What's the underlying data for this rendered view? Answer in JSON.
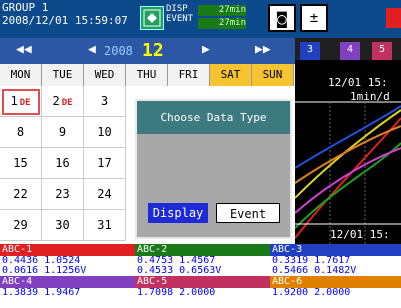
{
  "header": {
    "group": "GROUP 1",
    "datetime": "2008/12/01 15:59:07",
    "disp_label": "DISP",
    "event_label": "EVENT",
    "disp_value": "27min",
    "event_value": "27min"
  },
  "calendar": {
    "year": "2008",
    "month": "12",
    "nav": {
      "prev_year": "◀◀",
      "prev_month": "◀",
      "next_month": "▶",
      "next_year": "▶▶"
    },
    "weekdays": [
      "MON",
      "TUE",
      "WED",
      "THU",
      "FRI",
      "SAT",
      "SUN"
    ],
    "rows": [
      [
        "1",
        "2",
        "3",
        "",
        "",
        "",
        ""
      ],
      [
        "8",
        "9",
        "10",
        "",
        "",
        "",
        ""
      ],
      [
        "15",
        "16",
        "17",
        "",
        "",
        "",
        ""
      ],
      [
        "22",
        "23",
        "24",
        "",
        "",
        "",
        ""
      ],
      [
        "29",
        "30",
        "31",
        "",
        "",
        "",
        ""
      ]
    ],
    "day_mark": "DE"
  },
  "trend": {
    "tabs": [
      "3",
      "4",
      "5"
    ],
    "date_top": "12/01 15:",
    "rate": "1min/d",
    "date_bottom": "12/01 15:"
  },
  "dialog": {
    "title": "Choose Data Type",
    "display_button": "Display",
    "event_button": "Event"
  },
  "channels": [
    {
      "name": "ABC-1",
      "v1": "0.4436 1.0524",
      "v2": "0.0616 1.1256V",
      "color": "#e02020"
    },
    {
      "name": "ABC-2",
      "v1": "0.4753 1.4567",
      "v2": "0.4533 0.6563V",
      "color": "#1a7a1a"
    },
    {
      "name": "ABC-3",
      "v1": "0.3319 1.7617",
      "v2": "0.5466 0.1482V",
      "color": "#2040c0"
    },
    {
      "name": "ABC-4",
      "v1": "1.3839 1.9467",
      "v2": "",
      "color": "#8040c0"
    },
    {
      "name": "ABC-5",
      "v1": "1.7098 2.0000",
      "v2": "",
      "color": "#c03060"
    },
    {
      "name": "ABC-6",
      "v1": "1.9200 2.0000",
      "v2": "",
      "color": "#e08000"
    }
  ]
}
